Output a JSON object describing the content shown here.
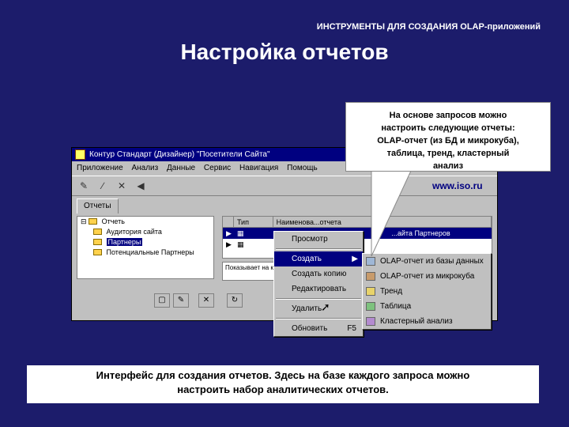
{
  "slide": {
    "header": "ИНСТРУМЕНТЫ ДЛЯ СОЗДАНИЯ OLAP-приложений",
    "title": "Настройка отчетов",
    "caption_line1": "Интерфейс для создания отчетов. Здесь на базе каждого запроса можно",
    "caption_line2": "настроить набор аналитических отчетов."
  },
  "callout": {
    "line1": "На основе запросов можно",
    "line2": "настроить следующие отчеты:",
    "line3": "OLAP-отчет (из БД и микрокуба),",
    "line4": "таблица, тренд, кластерный",
    "line5": "анализ"
  },
  "site_link": "www.iso.ru",
  "window": {
    "title": "Контур Стандарт (Дизайнер) \"Посетители Сайта\"",
    "menu": [
      "Приложение",
      "Анализ",
      "Данные",
      "Сервис",
      "Навигация",
      "Помощь"
    ],
    "tab": "Отчеты",
    "tree": {
      "root": "Отчеть",
      "children": [
        "Аудитория сайта",
        "Партнеры",
        "Потенциальные Партнеры"
      ]
    },
    "grid": {
      "col_type": "Тип",
      "col_name": "Наименова...отчета",
      "rows": [
        "...айта Партнеров",
        ""
      ]
    },
    "desc_text": "Показывает на какие ... источники ..."
  },
  "context_menu": {
    "items": [
      "Просмотр",
      "Создать",
      "Создать копию",
      "Редактировать",
      "Удалить",
      "Обновить"
    ],
    "refresh_shortcut": "F5"
  },
  "submenu": {
    "items": [
      "OLAP-отчет из базы данных",
      "OLAP-отчет из микрокуба",
      "Тренд",
      "Таблица",
      "Кластерный анализ"
    ]
  }
}
